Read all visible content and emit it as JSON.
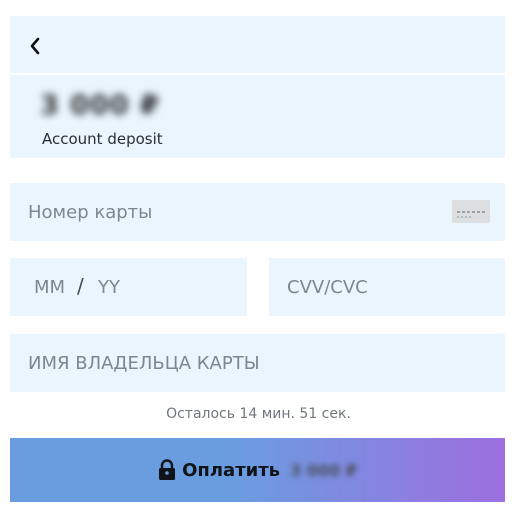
{
  "header": {
    "amount": "3 000 ₽",
    "caption": "Account deposit"
  },
  "form": {
    "card_number_placeholder": "Номер карты",
    "expiry_month_placeholder": "MM",
    "expiry_separator": "/",
    "expiry_year_placeholder": "YY",
    "cvv_placeholder": "CVV/CVC",
    "holder_placeholder": "ИМЯ ВЛАДЕЛЬЦА КАРТЫ"
  },
  "timer_text": "Осталось 14 мин. 51 сек.",
  "pay_button": {
    "label": "Оплатить",
    "amount": "3 000 ₽"
  },
  "colors": {
    "panel_background": "#ebf5fd",
    "button_gradient_start": "#6a9de0",
    "button_gradient_end": "#9d6fe0"
  },
  "icons": {
    "back": "chevron-left-icon",
    "card": "credit-card-icon",
    "lock": "lock-icon"
  }
}
